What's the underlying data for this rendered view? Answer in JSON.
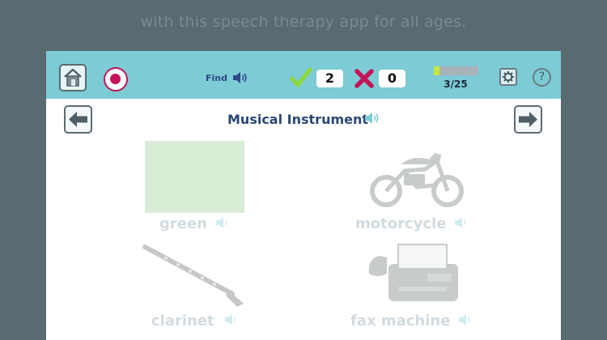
{
  "banner_text": "with this speech therapy app for all ages.",
  "toolbar": {
    "find_label": "Find",
    "correct_count": "2",
    "wrong_count": "0",
    "progress_text": "3/25",
    "progress_fraction": 0.12,
    "help_glyph": "?"
  },
  "category": {
    "title": "Musical Instrument"
  },
  "choices": [
    {
      "label": "green",
      "icon": "green-color-swatch"
    },
    {
      "label": "motorcycle",
      "icon": "motorcycle-icon"
    },
    {
      "label": "clarinet",
      "icon": "clarinet-icon"
    },
    {
      "label": "fax machine",
      "icon": "fax-machine-icon"
    }
  ],
  "colors": {
    "toolbar_bg": "#7ccbd5",
    "record_accent": "#c5135a",
    "check_color": "#8ed83a",
    "x_color": "#c5135a",
    "progress_fill": "#c7e63a",
    "background": "#5a6a71"
  }
}
